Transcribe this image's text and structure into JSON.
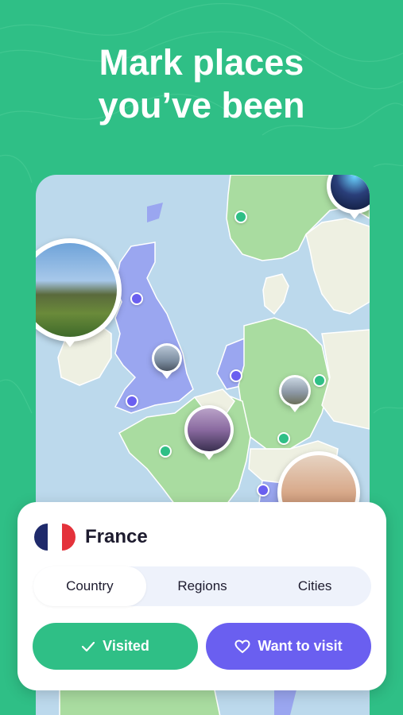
{
  "headline": {
    "line1": "Mark places",
    "line2": "you’ve been"
  },
  "colors": {
    "background": "#2fbf86",
    "accent_green": "#2fbf86",
    "accent_purple": "#6a5ff0",
    "sea": "#bcd9ec",
    "land": "#eef0e2",
    "visited_land": "#a9dca0",
    "wanted_land": "#9aa6f0"
  },
  "map": {
    "photo_pins": [
      {
        "name": "castle-photo",
        "subject": "castle"
      },
      {
        "name": "aurora-photo",
        "subject": "northern lights"
      },
      {
        "name": "london-photo",
        "subject": "london"
      },
      {
        "name": "eiffel-photo",
        "subject": "eiffel tower"
      },
      {
        "name": "castle-germany-photo",
        "subject": "castle"
      },
      {
        "name": "colosseum-photo",
        "subject": "colosseum"
      }
    ]
  },
  "country_sheet": {
    "country": "France",
    "flag_icon": "france-flag-icon",
    "tabs": [
      {
        "label": "Country",
        "active": true
      },
      {
        "label": "Regions",
        "active": false
      },
      {
        "label": "Cities",
        "active": false
      }
    ],
    "visited_button": {
      "label": "Visited",
      "icon": "check-icon"
    },
    "want_button": {
      "label": "Want to visit",
      "icon": "heart-icon"
    }
  }
}
